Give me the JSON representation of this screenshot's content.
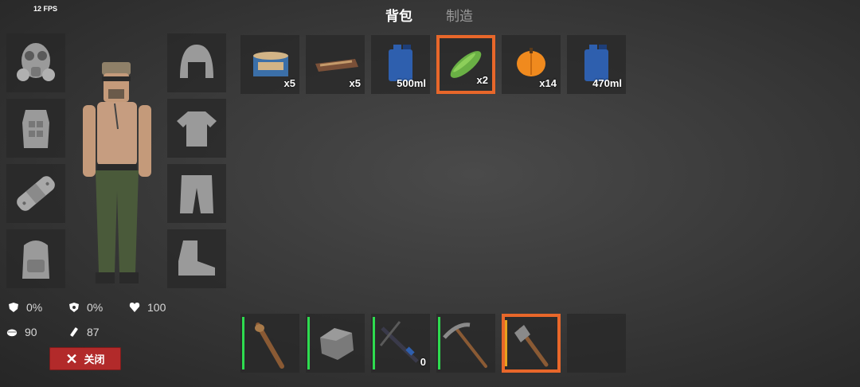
{
  "hud": {
    "fps": "12 FPS"
  },
  "tabs": [
    {
      "label": "背包",
      "active": true
    },
    {
      "label": "制造",
      "active": false
    }
  ],
  "equipment": {
    "left": [
      "gas-mask",
      "body-armor",
      "bandage",
      "backpack"
    ],
    "right": [
      "helmet",
      "t-shirt",
      "pants",
      "boots"
    ]
  },
  "inventory": [
    {
      "item": "canned-food",
      "qty": "x5"
    },
    {
      "item": "chocolate-bar",
      "qty": "x5"
    },
    {
      "item": "water-canister",
      "qty": "500ml"
    },
    {
      "item": "zucchini",
      "qty": "x2",
      "selected": true
    },
    {
      "item": "pumpkin",
      "qty": "x14"
    },
    {
      "item": "water-canister",
      "qty": "470ml"
    }
  ],
  "hotbar": [
    {
      "item": "wooden-club",
      "qty": "",
      "durability_color": "#2edc4f"
    },
    {
      "item": "stone",
      "qty": "",
      "durability_color": "#2edc4f"
    },
    {
      "item": "crossbow",
      "qty": "0",
      "durability_color": "#2edc4f"
    },
    {
      "item": "pickaxe",
      "qty": "",
      "durability_color": "#2edc4f"
    },
    {
      "item": "stone-axe",
      "qty": "",
      "durability_color": "#e6a21d",
      "selected": true
    },
    {
      "item": "empty",
      "qty": ""
    }
  ],
  "stats": {
    "armor": "0%",
    "resistance": "0%",
    "health": "100",
    "food": "90",
    "water": "87"
  },
  "close_button": {
    "label": "关闭"
  },
  "colors": {
    "accent": "#e8672a",
    "close": "#b22a2a",
    "durability": "#2edc4f"
  }
}
